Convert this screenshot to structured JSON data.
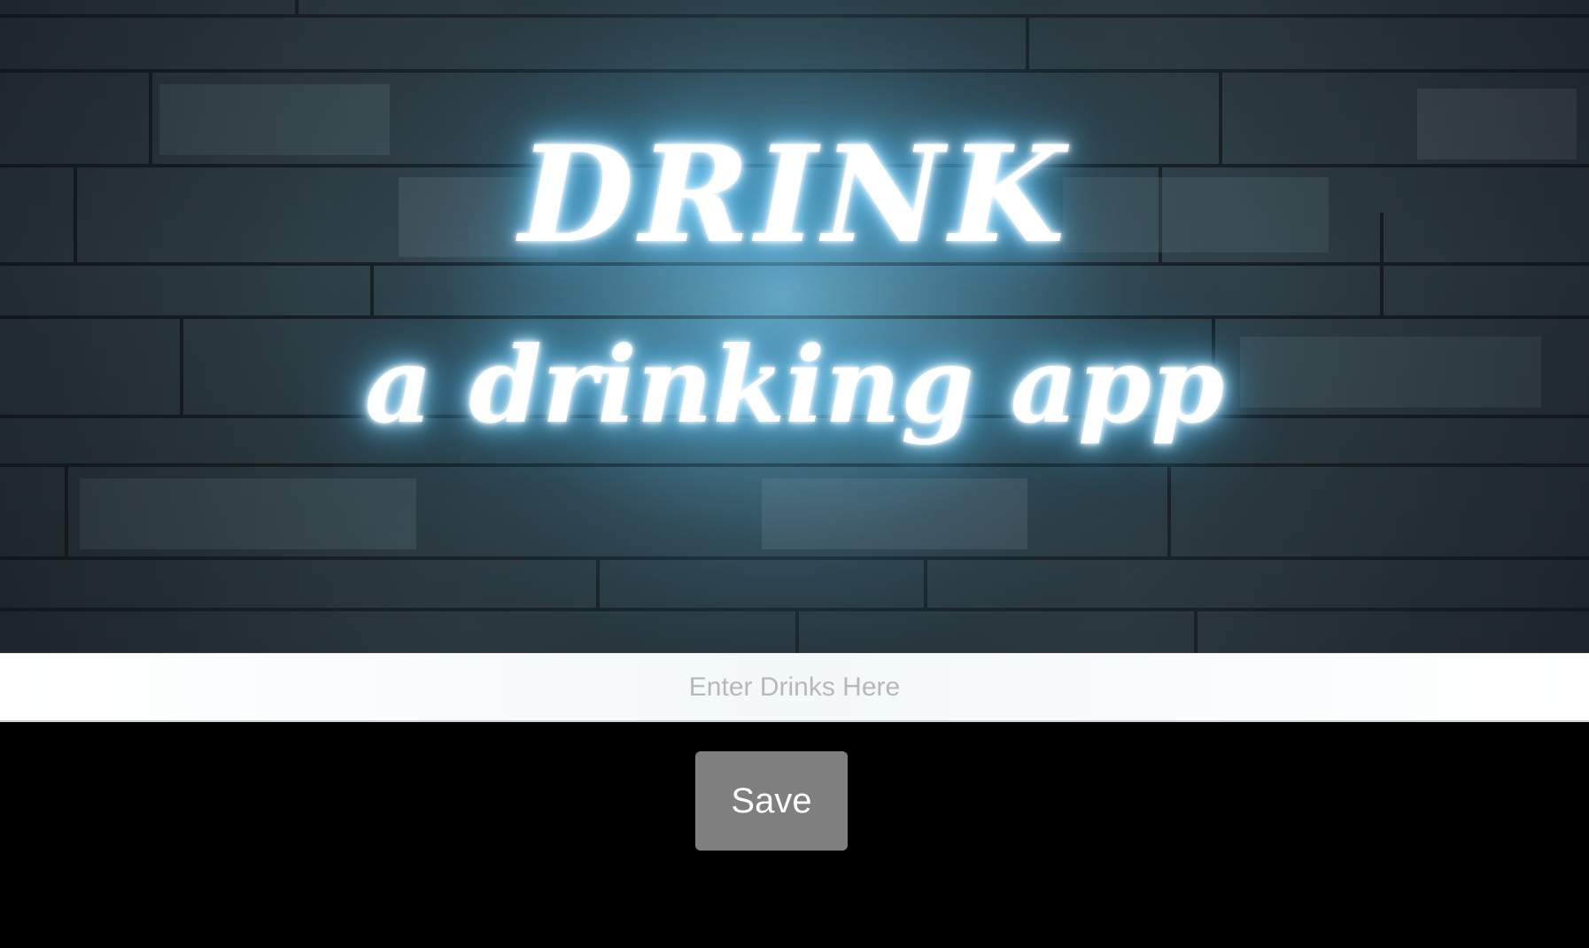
{
  "hero": {
    "title": "DRINK",
    "subtitle": "a drinking app",
    "glow_color": "#8fd6ff"
  },
  "form": {
    "input": {
      "placeholder": "Enter Drinks Here",
      "value": ""
    },
    "save_label": "Save",
    "save_color": "#7f7f7f"
  },
  "background_color": "#000000"
}
